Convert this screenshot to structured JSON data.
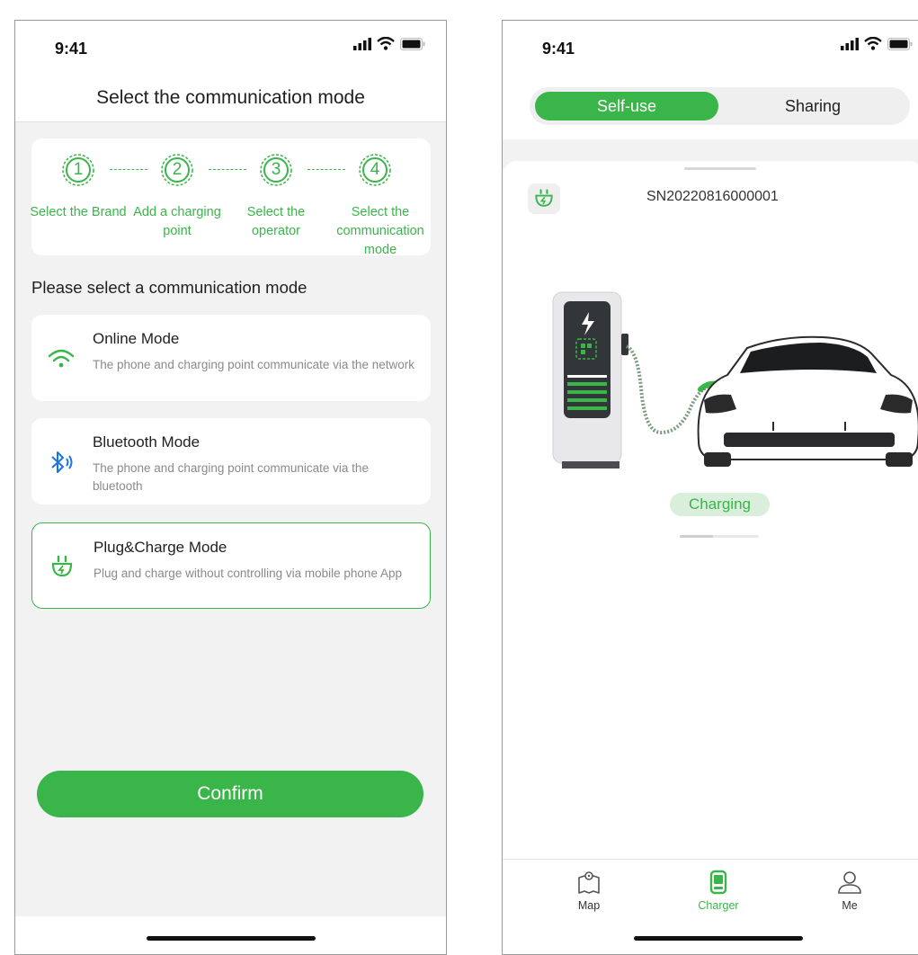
{
  "status_bar": {
    "time": "9:41"
  },
  "communication_screen": {
    "title": "Select the communication mode",
    "steps": [
      {
        "number": "1",
        "label": "Select the Brand"
      },
      {
        "number": "2",
        "label": "Add a charging point"
      },
      {
        "number": "3",
        "label": "Select the operator"
      },
      {
        "number": "4",
        "label": "Select the communication mode"
      }
    ],
    "section_title": "Please select a communication mode",
    "modes": [
      {
        "title": "Online Mode",
        "description": "The phone and charging point communicate via the network",
        "icon": "wifi-icon"
      },
      {
        "title": "Bluetooth Mode",
        "description": "The phone and charging point communicate via the bluetooth",
        "icon": "bluetooth-icon"
      },
      {
        "title": "Plug&Charge Mode",
        "description": "Plug and charge without controlling via mobile phone App",
        "icon": "plug-icon"
      }
    ],
    "selected_mode": "Plug&Charge Mode",
    "confirm_label": "Confirm"
  },
  "charger_screen": {
    "segments": {
      "active": "Self-use",
      "inactive": "Sharing"
    },
    "serial_number": "SN20220816000001",
    "status": "Charging",
    "progress": 0.42,
    "tabs": [
      {
        "label": "Map",
        "icon": "map-icon"
      },
      {
        "label": "Charger",
        "icon": "charger-icon",
        "active": true
      },
      {
        "label": "Me",
        "icon": "person-icon"
      }
    ]
  },
  "colors": {
    "accent": "#3ab54a",
    "accent_light": "#d9eedb",
    "background": "#f2f2f3",
    "bluetooth": "#1a73e8"
  }
}
